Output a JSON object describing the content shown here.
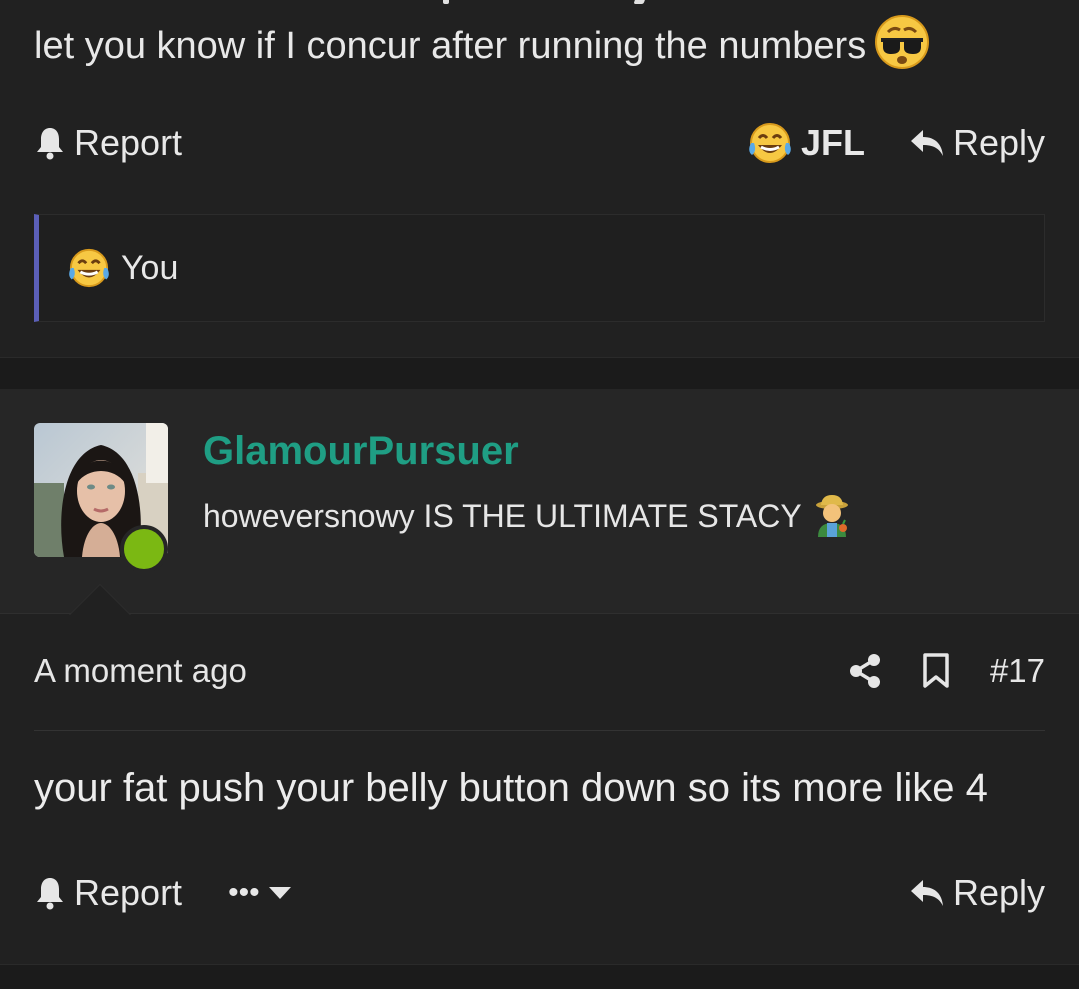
{
  "previous_post": {
    "text": "let you know if I concur after running the numbers",
    "trailing_emoji": "cool-sunglasses-emoji",
    "actions": {
      "report_label": "Report",
      "reaction_label": "JFL",
      "reply_label": "Reply"
    },
    "reactions_bar": {
      "reactor": "You",
      "emoji": "laughing-crying-emoji"
    }
  },
  "post": {
    "username": "GlamourPursuer",
    "user_title": "howeversnowy IS THE ULTIMATE STACY",
    "user_title_emoji": "farmer-emoji",
    "online": true,
    "timestamp": "A moment ago",
    "post_number": "#17",
    "body": "your fat push your belly button down so its more like 4",
    "actions": {
      "report_label": "Report",
      "more_label": "•••",
      "reply_label": "Reply"
    }
  },
  "colors": {
    "background": "#212121",
    "username": "#1f9e84",
    "online_dot": "#7bb813",
    "reaction_accent": "#5b5fb8"
  }
}
